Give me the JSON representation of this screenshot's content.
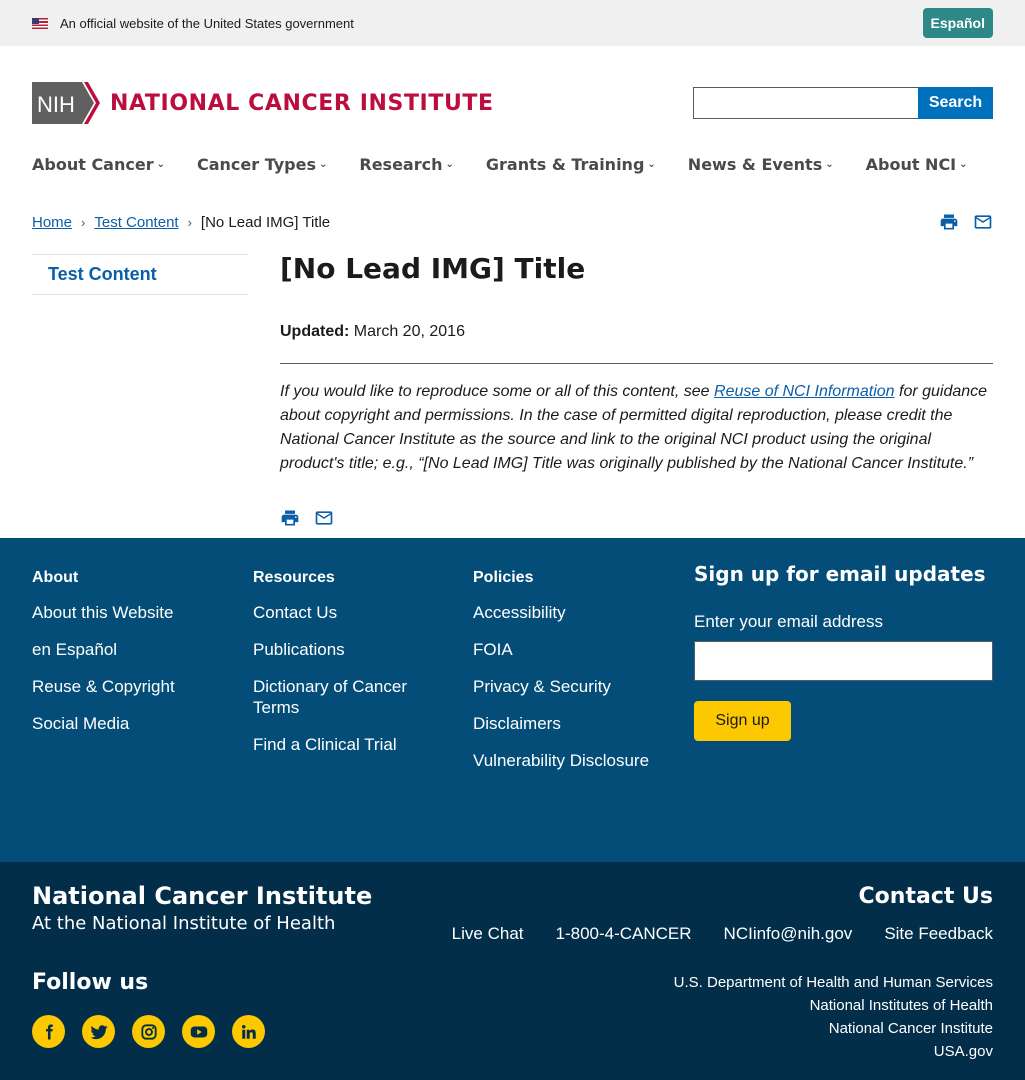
{
  "gov_banner": {
    "text": "An official website of the United States government",
    "language_button": "Español"
  },
  "header": {
    "nih_mark": "NIH",
    "institute_name": "NATIONAL CANCER INSTITUTE",
    "search_placeholder": "",
    "search_button": "Search"
  },
  "nav": {
    "items": [
      {
        "label": "About Cancer"
      },
      {
        "label": "Cancer Types"
      },
      {
        "label": "Research"
      },
      {
        "label": "Grants & Training"
      },
      {
        "label": "News & Events"
      },
      {
        "label": "About NCI"
      }
    ]
  },
  "breadcrumb": {
    "home": "Home",
    "section": "Test Content",
    "current": "[No Lead IMG] Title"
  },
  "sidebar": {
    "item": "Test Content"
  },
  "main": {
    "title": "[No Lead IMG] Title",
    "updated_label": "Updated:",
    "updated_value": "March 20, 2016",
    "reuse_before": "If you would like to reproduce some or all of this content, see ",
    "reuse_link": "Reuse of NCI Information",
    "reuse_after": " for guidance about copyright and permissions. In the case of permitted digital reproduction, please credit the National Cancer Institute as the source and link to the original NCI product using the original product's title; e.g., “[No Lead IMG] Title was originally published by the National Cancer Institute.”"
  },
  "footer": {
    "about": {
      "heading": "About",
      "links": [
        "About this Website",
        "en Español",
        "Reuse & Copyright",
        "Social Media"
      ]
    },
    "resources": {
      "heading": "Resources",
      "links": [
        "Contact Us",
        "Publications",
        "Dictionary of Cancer Terms",
        "Find a Clinical Trial"
      ]
    },
    "policies": {
      "heading": "Policies",
      "links": [
        "Accessibility",
        "FOIA",
        "Privacy & Security",
        "Disclaimers",
        "Vulnerability Disclosure"
      ]
    },
    "signup": {
      "heading": "Sign up for email updates",
      "label": "Enter your email address",
      "button": "Sign up"
    },
    "bottom": {
      "title": "National Cancer Institute",
      "subtitle": "At the National Institute of Health",
      "follow": "Follow us",
      "contact_title": "Contact Us",
      "contact_links": [
        "Live Chat",
        "1-800-4-CANCER",
        "NCIinfo@nih.gov",
        "Site Feedback"
      ],
      "agencies": [
        "U.S. Department of Health and Human Services",
        "National Institutes of Health",
        "National Cancer Institute",
        "USA.gov"
      ]
    }
  },
  "social_icons": [
    "facebook-icon",
    "twitter-icon",
    "instagram-icon",
    "youtube-icon",
    "linkedin-icon"
  ],
  "colors": {
    "brand_red": "#bb0e3d",
    "link_blue": "#0b5ea8",
    "footer_blue": "#044d78",
    "footer_dark": "#022e4a",
    "accent_yellow": "#fcc800",
    "espanol_teal": "#2f8888"
  }
}
